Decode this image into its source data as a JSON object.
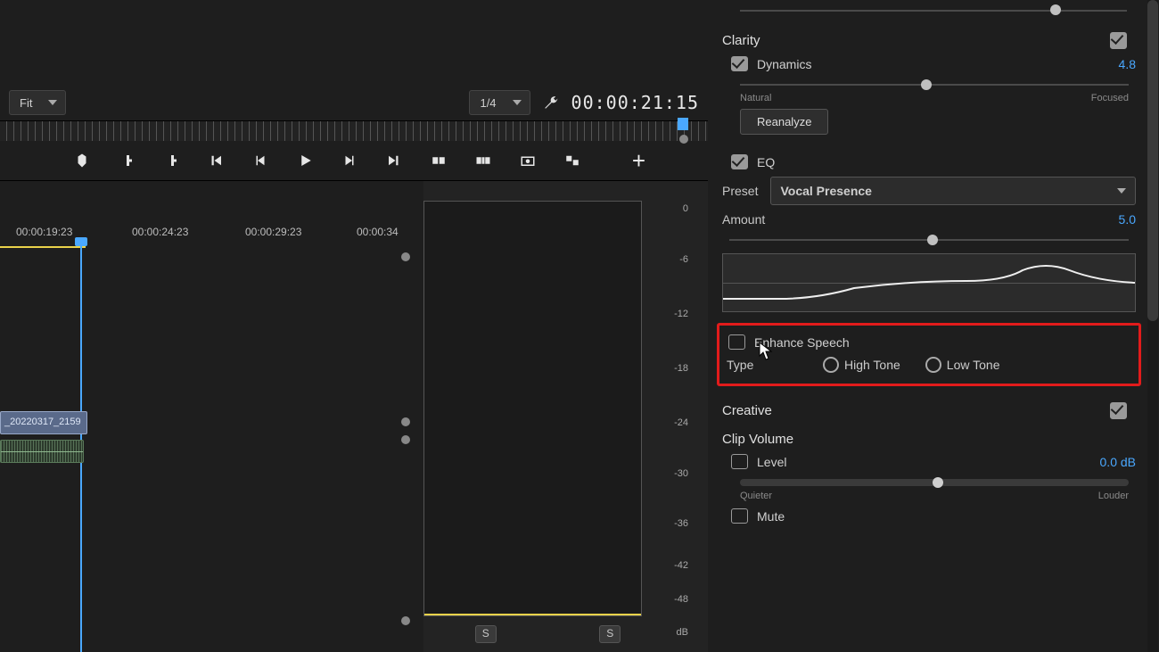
{
  "left": {
    "fit": "Fit",
    "zoom": "1/4",
    "timecode": "00:00:21:15",
    "timeline_marks": [
      "00:00:19:23",
      "00:00:24:23",
      "00:00:29:23",
      "00:00:34"
    ],
    "clip_name": "_20220317_2159",
    "meter_labels": [
      "0",
      "-6",
      "-12",
      "-18",
      "-24",
      "-30",
      "-36",
      "-42",
      "-48",
      "dB"
    ],
    "solo": "S"
  },
  "panel": {
    "clarity": {
      "title": "Clarity",
      "dynamics_label": "Dynamics",
      "dynamics_value": "4.8",
      "natural": "Natural",
      "focused": "Focused",
      "reanalyze": "Reanalyze",
      "eq_label": "EQ",
      "preset_label": "Preset",
      "preset_value": "Vocal Presence",
      "amount_label": "Amount",
      "amount_value": "5.0"
    },
    "enhance": {
      "label": "Enhance Speech",
      "type": "Type",
      "high": "High Tone",
      "low": "Low Tone"
    },
    "creative": {
      "title": "Creative"
    },
    "clipvol": {
      "title": "Clip Volume",
      "level": "Level",
      "level_val": "0.0 dB",
      "quieter": "Quieter",
      "louder": "Louder",
      "mute": "Mute"
    }
  }
}
